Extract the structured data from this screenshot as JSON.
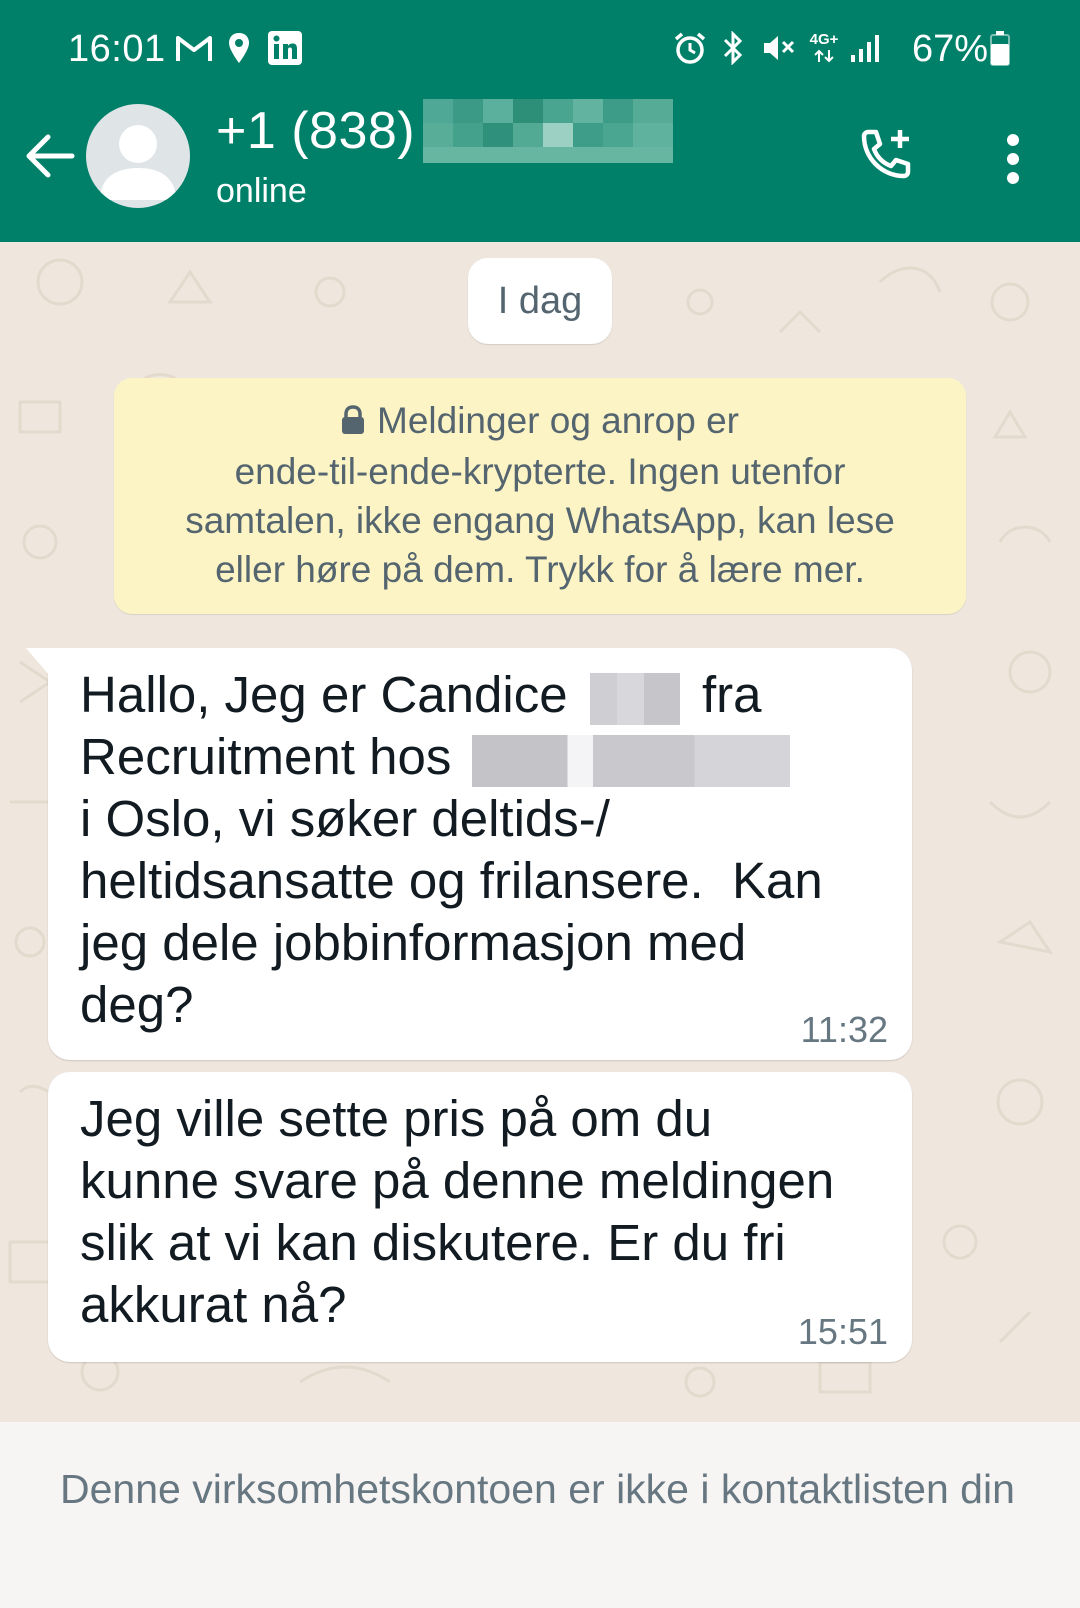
{
  "status_bar": {
    "time": "16:01",
    "battery_percent": "67%",
    "network_label": "4G+",
    "left_icons": [
      "gmail-icon",
      "location-icon",
      "linkedin-icon"
    ],
    "right_icons": [
      "alarm-icon",
      "bluetooth-icon",
      "mute-icon",
      "4g-data-icon",
      "signal-icon",
      "battery-icon"
    ]
  },
  "header": {
    "contact_number": "+1 (838)",
    "contact_status": "online",
    "icons": [
      "back-arrow-icon",
      "default-avatar-icon",
      "add-call-icon",
      "more-vert-icon"
    ]
  },
  "chat": {
    "date_chip": "I dag",
    "encryption_notice": {
      "lines": [
        "Meldinger og anrop er",
        "ende-til-ende-krypterte. Ingen utenfor",
        "samtalen, ikke engang WhatsApp, kan lese",
        "eller høre på dem. Trykk for å lære mer."
      ]
    },
    "messages": [
      {
        "time": "11:32",
        "parts": {
          "p1": "Hallo, Jeg er Candice",
          "p2": "fra",
          "p3": "Recruitment hos",
          "p4": "i Oslo, vi søker deltids-/",
          "p5": "heltidsansatte og frilansere.  Kan",
          "p6": "jeg dele jobbinformasjon med",
          "p7": "deg?"
        }
      },
      {
        "time": "15:51",
        "lines": [
          "Jeg ville sette pris på om du",
          "kunne svare på denne meldingen",
          "slik at vi kan diskutere. Er du fri",
          "akkurat nå?"
        ]
      }
    ]
  },
  "footer": {
    "text": "Denne virksomhetskontoen er ikke i kontaktlisten din"
  },
  "colors": {
    "header": "#008069",
    "chat_background": "#efe7de",
    "notice_background": "#fdf4c5",
    "bubble": "#ffffff",
    "footer": "#f7f5f3"
  }
}
